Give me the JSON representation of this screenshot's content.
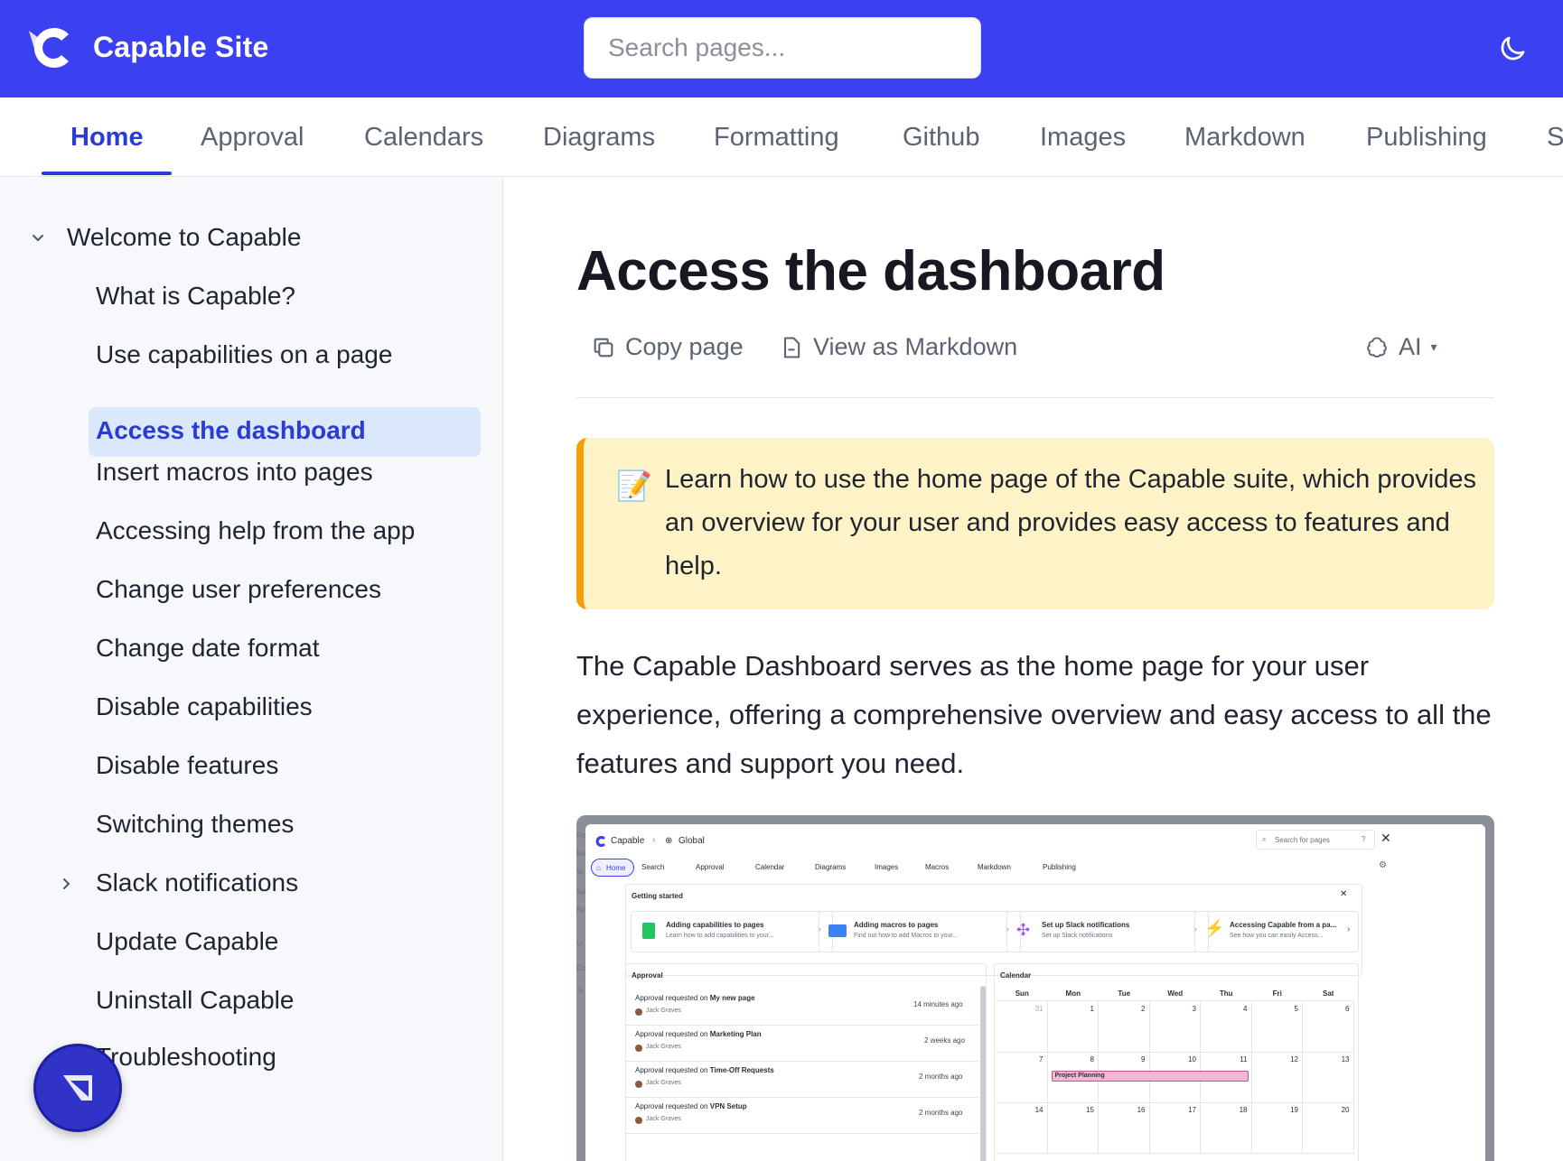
{
  "header": {
    "site_title": "Capable Site",
    "search_placeholder": "Search pages..."
  },
  "tabs": [
    "Home",
    "Approval",
    "Calendars",
    "Diagrams",
    "Formatting",
    "Github",
    "Images",
    "Markdown",
    "Publishing",
    "S"
  ],
  "sidebar": {
    "group": "Welcome to Capable",
    "items": [
      "What is Capable?",
      "Use capabilities on a page",
      "Access the dashboard",
      "Insert macros into pages",
      "Accessing help from the app",
      "Change user preferences",
      "Change date format",
      "Disable capabilities",
      "Disable features",
      "Switching themes",
      "Slack notifications",
      "Update Capable",
      "Uninstall Capable",
      "Troubleshooting"
    ],
    "active_item": "Access the dashboard"
  },
  "main": {
    "title": "Access the dashboard",
    "actions": {
      "copy": "Copy page",
      "markdown": "View as Markdown",
      "ai": "AI",
      "ai_caret": "▾"
    },
    "callout": {
      "emoji": "📝",
      "text": "Learn how to use the home page of the Capable suite, which provides an overview for your user and provides easy access to features and help."
    },
    "body": "The Capable Dashboard serves as the home page for your user experience, offering a comprehensive overview and easy access to all the features and support you need."
  },
  "screenshot": {
    "breadcrumb_app": "Capable",
    "breadcrumb_scope": "Global",
    "search_placeholder": "Search for pages",
    "help": "?",
    "nav": [
      "Home",
      "Search",
      "Approval",
      "Calendar",
      "Diagrams",
      "Images",
      "Macros",
      "Markdown",
      "Publishing"
    ],
    "getting_started": "Getting started",
    "cards": [
      {
        "title": "Adding capabilities to pages",
        "desc": "Learn how to add capabilities to your..."
      },
      {
        "title": "Adding macros to pages",
        "desc": "Find out how to add Macros to your..."
      },
      {
        "title": "Set up Slack notifications",
        "desc": "Set up Slack notifications"
      },
      {
        "title": "Accessing Capable from a pa...",
        "desc": "See how you can easily Access..."
      }
    ],
    "approval_title": "Approval",
    "approval_prefix": "Approval requested on",
    "approvals": [
      {
        "page": "My new page",
        "user": "Jack Graves",
        "time": "14 minutes ago"
      },
      {
        "page": "Marketing Plan",
        "user": "Jack Graves",
        "time": "2 weeks ago"
      },
      {
        "page": "Time-Off Requests",
        "user": "Jack Graves",
        "time": "2 months ago"
      },
      {
        "page": "VPN Setup",
        "user": "Jack Graves",
        "time": "2 months ago"
      }
    ],
    "calendar_title": "Calendar",
    "weekdays": [
      "Sun",
      "Mon",
      "Tue",
      "Wed",
      "Thu",
      "Fri",
      "Sat"
    ],
    "week1": [
      "31",
      "1",
      "2",
      "3",
      "4",
      "5",
      "6"
    ],
    "week2": [
      "7",
      "8",
      "9",
      "10",
      "11",
      "12",
      "13"
    ],
    "week3": [
      "14",
      "15",
      "16",
      "17",
      "18",
      "19",
      "20"
    ],
    "event": "Project Planning",
    "behind_letters": [
      "Fo",
      "Re",
      "St",
      "Sp",
      "Ap",
      "Vi",
      "Co",
      "S"
    ]
  },
  "colors": {
    "brand": "#3b40f0",
    "active": "#2b3bd6",
    "callout_bg": "#fef3c7",
    "callout_border": "#f59e0b"
  }
}
